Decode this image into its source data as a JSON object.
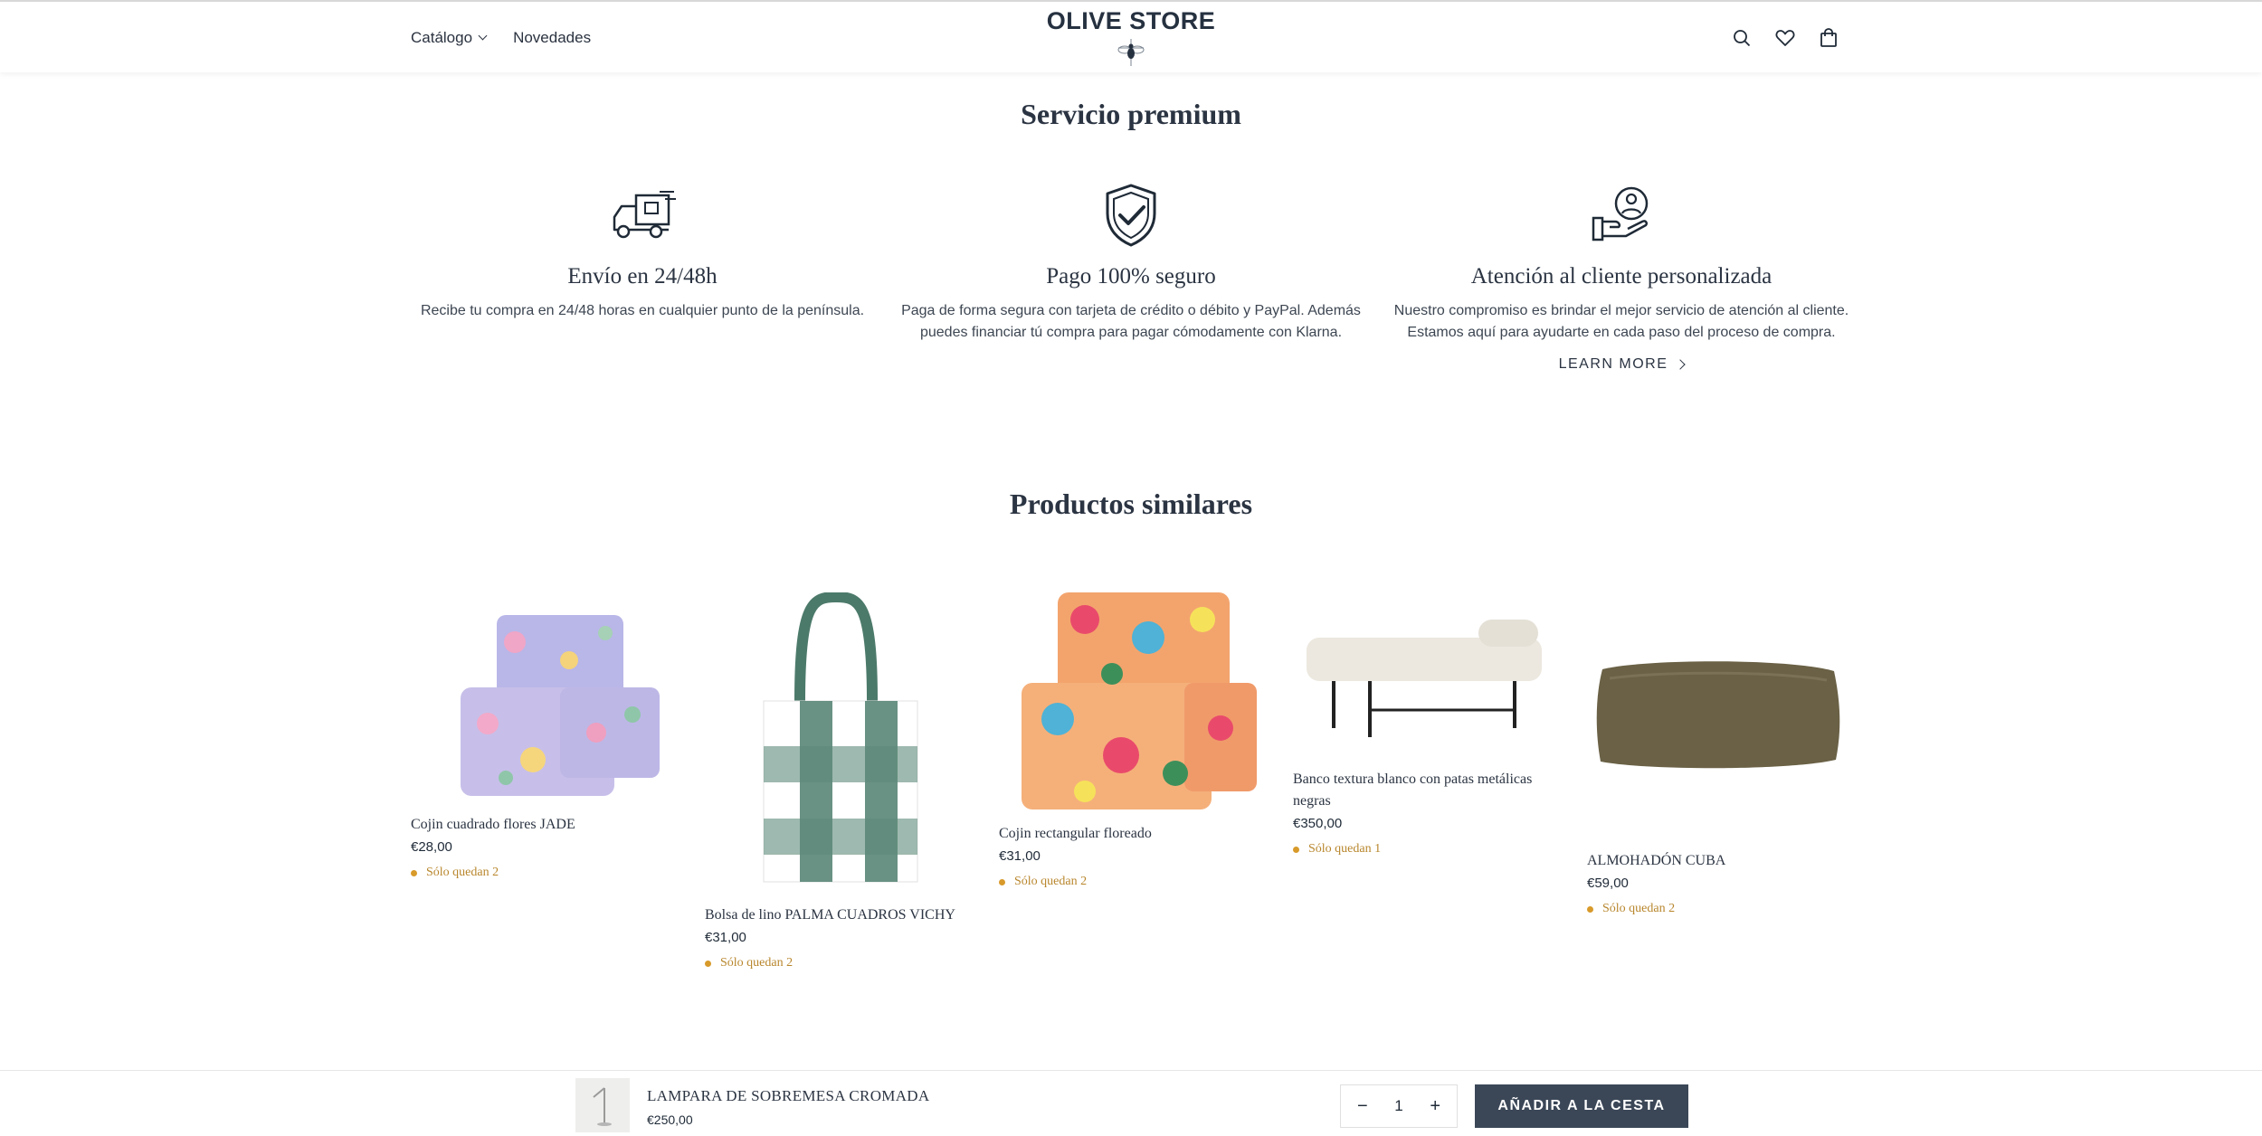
{
  "header": {
    "nav": [
      {
        "label": "Catálogo",
        "has_dropdown": true
      },
      {
        "label": "Novedades",
        "has_dropdown": false
      }
    ],
    "logo_text": "OLIVE STORE",
    "icons": [
      "search-icon",
      "heart-icon",
      "bag-icon"
    ]
  },
  "service": {
    "title": "Servicio premium",
    "items": [
      {
        "icon": "truck-icon",
        "title": "Envío en 24/48h",
        "text": "Recibe tu compra en 24/48 horas en cualquier punto de la península."
      },
      {
        "icon": "shield-check-icon",
        "title": "Pago 100% seguro",
        "text": "Paga de forma segura con tarjeta de crédito o débito y PayPal. Además puedes financiar tú compra para pagar cómodamente con Klarna."
      },
      {
        "icon": "hand-user-icon",
        "title": "Atención al cliente personalizada",
        "text": "Nuestro compromiso es brindar el mejor servicio de atención al cliente. Estamos aquí para ayudarte en cada paso del proceso de compra."
      }
    ],
    "learn_more": "LEARN MORE"
  },
  "similar": {
    "title": "Productos similares",
    "products": [
      {
        "name": "Cojin cuadrado flores JADE",
        "price": "€28,00",
        "stock": "Sólo quedan 2"
      },
      {
        "name": "Bolsa de lino PALMA CUADROS VICHY",
        "price": "€31,00",
        "stock": "Sólo quedan 2"
      },
      {
        "name": "Cojin rectangular floreado",
        "price": "€31,00",
        "stock": "Sólo quedan 2"
      },
      {
        "name": "Banco textura blanco con patas metálicas negras",
        "price": "€350,00",
        "stock": "Sólo quedan 1"
      },
      {
        "name": "ALMOHADÓN CUBA",
        "price": "€59,00",
        "stock": "Sólo quedan 2"
      }
    ]
  },
  "sticky": {
    "product_name": "LAMPARA DE SOBREMESA CROMADA",
    "price": "€250,00",
    "quantity": "1",
    "minus": "−",
    "plus": "+",
    "add_to_cart": "AÑADIR A LA CESTA"
  }
}
